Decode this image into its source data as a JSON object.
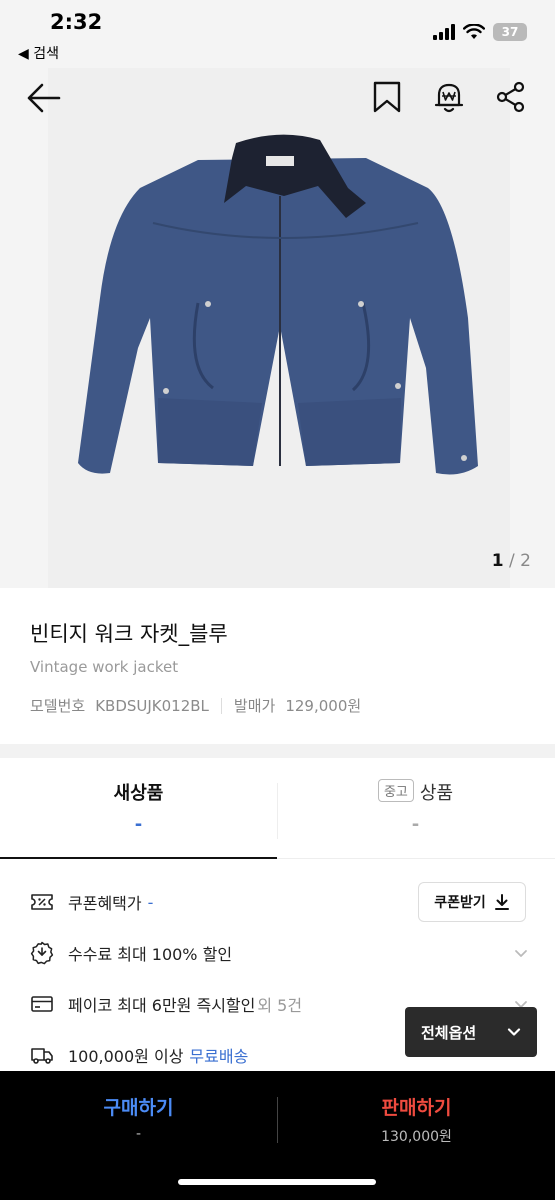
{
  "status": {
    "time": "2:32",
    "back_app": "◀ 검색",
    "battery": "37"
  },
  "gallery": {
    "current": "1",
    "separator": " / ",
    "total": "2"
  },
  "product": {
    "title_ko": "빈티지 워크 자켓_블루",
    "title_en": "Vintage work jacket",
    "model_label": "모델번호",
    "model_value": "KBDSUJK012BL",
    "release_label": "발매가",
    "release_value": "129,000원"
  },
  "tabs": {
    "new_label": "새상품",
    "new_value": "-",
    "used_badge": "중고",
    "used_label": "상품",
    "used_value": "-"
  },
  "benefits": {
    "coupon_label": "쿠폰혜택가",
    "coupon_value": "-",
    "coupon_button": "쿠폰받기",
    "fee_label": "수수료 최대 100% 할인",
    "pay_label": "페이코 최대 6만원 즉시할인",
    "pay_extra": "외 5건",
    "shipping_label": "100,000원 이상",
    "shipping_accent": "무료배송"
  },
  "all_options_label": "전체옵션",
  "bottom": {
    "buy_label": "구매하기",
    "buy_price": "-",
    "sell_label": "판매하기",
    "sell_price": "130,000원"
  },
  "colors": {
    "buy": "#4b8bf5",
    "sell": "#ef4b3f",
    "accent": "#3a6fd1"
  }
}
